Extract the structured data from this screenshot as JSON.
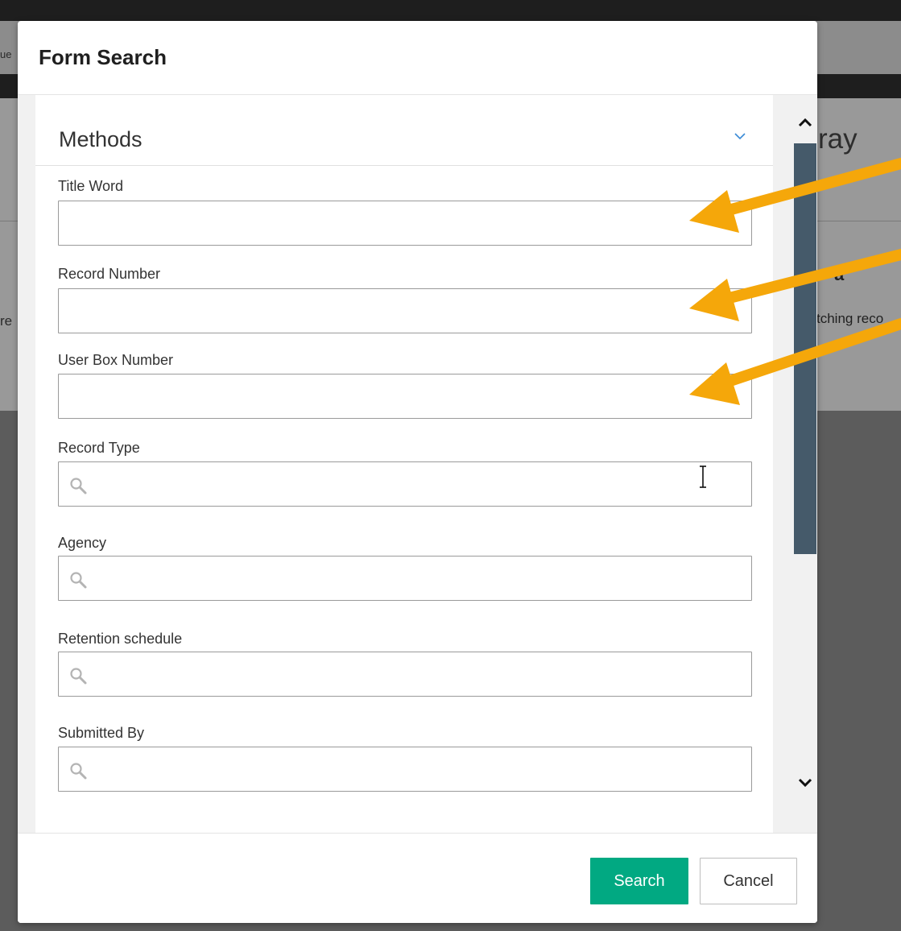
{
  "background": {
    "left_edge_fragment_1": "ue",
    "left_edge_fragment_2": "re",
    "title_fragment": "ray",
    "heading_fragment": "a",
    "body_fragment": "tching reco"
  },
  "modal": {
    "title": "Form Search",
    "section": {
      "title": "Methods",
      "chevron_icon": "chevron-down-icon"
    },
    "fields": [
      {
        "label": "Title Word",
        "value": "",
        "has_search_icon": false
      },
      {
        "label": "Record Number",
        "value": "",
        "has_search_icon": false
      },
      {
        "label": "User Box Number",
        "value": "",
        "has_search_icon": false
      },
      {
        "label": "Record Type",
        "value": "",
        "has_search_icon": true
      },
      {
        "label": "Agency",
        "value": "",
        "has_search_icon": true
      },
      {
        "label": "Retention schedule",
        "value": "",
        "has_search_icon": true
      },
      {
        "label": "Submitted By",
        "value": "",
        "has_search_icon": true
      }
    ],
    "buttons": {
      "search": "Search",
      "cancel": "Cancel"
    }
  },
  "colors": {
    "primary_button": "#01a982",
    "scrollbar_thumb": "#455a6a",
    "annotation_arrow": "#f5a70a",
    "section_chevron": "#3a8ad6"
  }
}
